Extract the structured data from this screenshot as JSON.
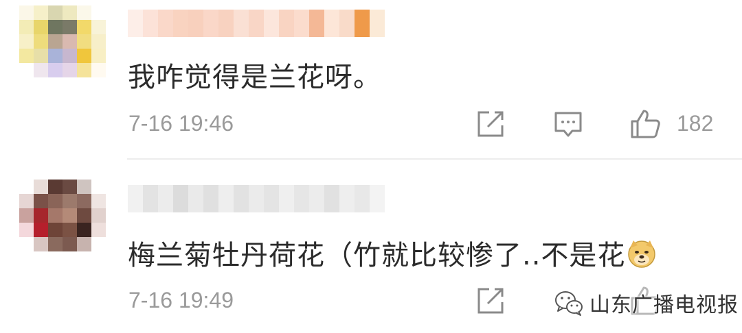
{
  "comments": [
    {
      "text": "我咋觉得是兰花呀。",
      "timestamp": "7-16 19:46",
      "like_count": "182"
    },
    {
      "text": "梅兰菊牡丹荷花（竹就比较惨了..不是花",
      "timestamp": "7-16 19:49"
    }
  ],
  "watermark": {
    "text": "山东广播电视报"
  },
  "icons": {
    "share": "share-edit-icon",
    "reply": "comment-bubble-icon",
    "like": "thumbs-up-icon",
    "emoji": "doge-emoji-icon",
    "watermark_logo": "wechat-logo-icon"
  },
  "colors": {
    "text": "#2b2b2b",
    "meta": "#9a9a9a",
    "divider": "#ededed"
  }
}
